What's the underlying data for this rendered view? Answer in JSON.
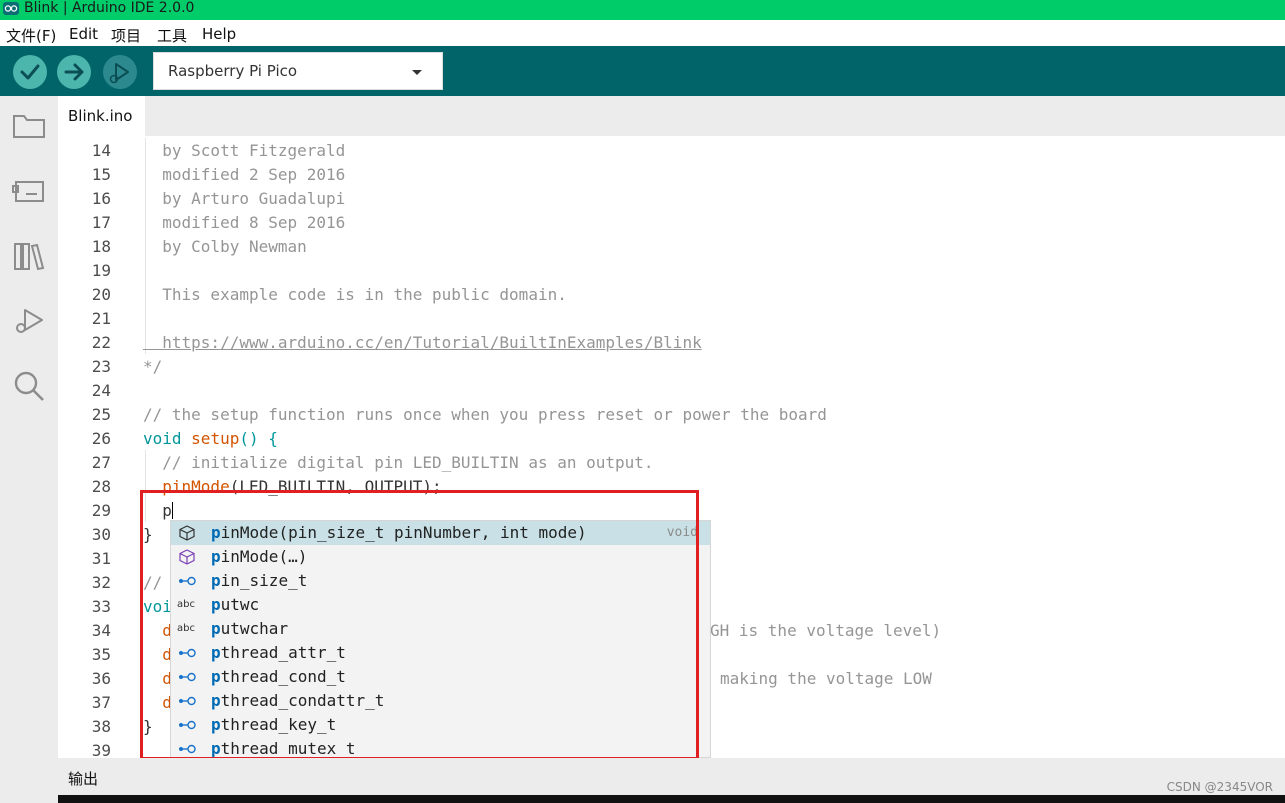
{
  "window": {
    "title": "Blink | Arduino IDE 2.0.0"
  },
  "menu": [
    "文件(F)",
    "Edit",
    "项目",
    "工具",
    "Help"
  ],
  "toolbar": {
    "verify_icon": "checkmark-icon",
    "upload_icon": "arrow-right-icon",
    "debug_icon": "debug-play-icon",
    "board": "Raspberry Pi Pico"
  },
  "sidebar": [
    "folder-icon",
    "board-icon",
    "library-icon",
    "debug-icon",
    "search-icon"
  ],
  "tab": {
    "label": "Blink.ino"
  },
  "code_lines": [
    {
      "n": "14",
      "text": "  by Scott Fitzgerald"
    },
    {
      "n": "15",
      "text": "  modified 2 Sep 2016"
    },
    {
      "n": "16",
      "text": "  by Arturo Guadalupi"
    },
    {
      "n": "17",
      "text": "  modified 8 Sep 2016"
    },
    {
      "n": "18",
      "text": "  by Colby Newman"
    },
    {
      "n": "19",
      "text": ""
    },
    {
      "n": "20",
      "text": "  This example code is in the public domain."
    },
    {
      "n": "21",
      "text": ""
    },
    {
      "n": "22",
      "text": "  https://www.arduino.cc/en/Tutorial/BuiltInExamples/Blink"
    },
    {
      "n": "23",
      "text": "*/"
    },
    {
      "n": "24",
      "text": ""
    },
    {
      "n": "25",
      "text": "// the setup function runs once when you press reset or power the board"
    },
    {
      "n": "26",
      "text": "void setup() {"
    },
    {
      "n": "27",
      "text": "  // initialize digital pin LED_BUILTIN as an output."
    },
    {
      "n": "28",
      "text": "  pinMode(LED_BUILTIN, OUTPUT);"
    },
    {
      "n": "29",
      "text": "  p"
    },
    {
      "n": "30",
      "text": "}"
    },
    {
      "n": "31",
      "text": ""
    },
    {
      "n": "32",
      "text": "//"
    },
    {
      "n": "33",
      "text": "voi"
    },
    {
      "n": "34",
      "text": "  d"
    },
    {
      "n": "35",
      "text": "  d"
    },
    {
      "n": "36",
      "text": "  d"
    },
    {
      "n": "37",
      "text": "  d"
    },
    {
      "n": "38",
      "text": "}"
    },
    {
      "n": "39",
      "text": ""
    }
  ],
  "code_overflow": {
    "line34": "GH is the voltage level)",
    "line36": "making the voltage LOW"
  },
  "suggestions": [
    {
      "icon": "method-icon",
      "match": "p",
      "rest": "inMode(pin_size_t pinNumber, int mode)",
      "detail": "void",
      "selected": true
    },
    {
      "icon": "method-icon",
      "match": "p",
      "rest": "inMode(…)",
      "detail": "",
      "selected": false
    },
    {
      "icon": "struct-icon",
      "match": "p",
      "rest": "in_size_t",
      "detail": "",
      "selected": false
    },
    {
      "icon": "text-abc-icon",
      "match": "p",
      "rest": "utwc",
      "detail": "",
      "selected": false
    },
    {
      "icon": "text-abc-icon",
      "match": "p",
      "rest": "utwchar",
      "detail": "",
      "selected": false
    },
    {
      "icon": "struct-icon",
      "match": "p",
      "rest": "thread_attr_t",
      "detail": "",
      "selected": false
    },
    {
      "icon": "struct-icon",
      "match": "p",
      "rest": "thread_cond_t",
      "detail": "",
      "selected": false
    },
    {
      "icon": "struct-icon",
      "match": "p",
      "rest": "thread_condattr_t",
      "detail": "",
      "selected": false
    },
    {
      "icon": "struct-icon",
      "match": "p",
      "rest": "thread_key_t",
      "detail": "",
      "selected": false
    },
    {
      "icon": "struct-icon",
      "match": "p",
      "rest": "thread_mutex_t",
      "detail": "",
      "selected": false
    }
  ],
  "output": {
    "label": "输出"
  },
  "watermark": "CSDN @2345VOR",
  "colors": {
    "titlebar": "#00cc6a",
    "toolbar": "#006469",
    "accent": "#00979c",
    "highlight_box": "#e02020"
  }
}
